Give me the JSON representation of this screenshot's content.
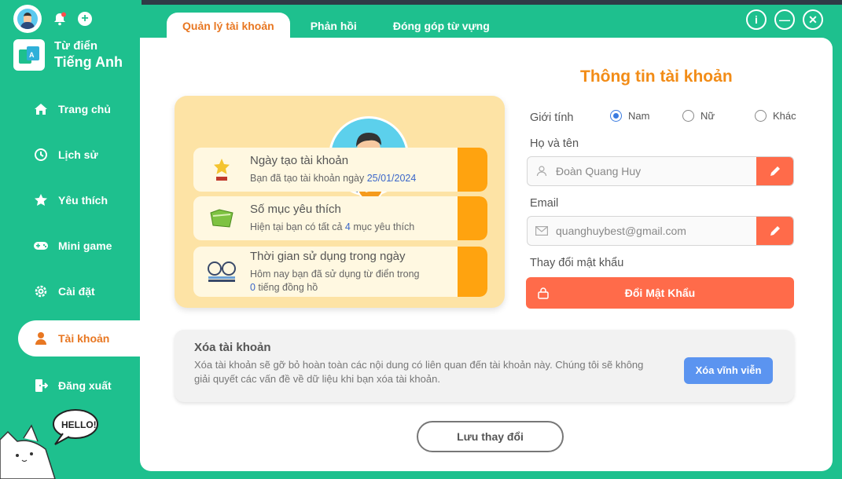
{
  "sidebar": {
    "app_title_line1": "Từ điển",
    "app_title_line2": "Tiếng Anh",
    "items": [
      {
        "label": "Trang chủ",
        "icon": "home-icon"
      },
      {
        "label": "Lịch sử",
        "icon": "history-icon"
      },
      {
        "label": "Yêu thích",
        "icon": "star-icon"
      },
      {
        "label": "Mini game",
        "icon": "gamepad-icon"
      },
      {
        "label": "Cài đặt",
        "icon": "gear-icon"
      },
      {
        "label": "Tài khoản",
        "icon": "user-icon",
        "active": true
      },
      {
        "label": "Đăng xuất",
        "icon": "logout-icon"
      }
    ],
    "mascot_text": "HELLO!"
  },
  "tabs": [
    {
      "label": "Quản lý tài khoản",
      "active": true
    },
    {
      "label": "Phản hồi"
    },
    {
      "label": "Đóng góp từ vựng"
    }
  ],
  "window_controls": {
    "info": "i",
    "minimize": "—",
    "close": "✕"
  },
  "stats": [
    {
      "title": "Ngày tạo tài khoản",
      "desc_prefix": "Bạn đã tạo tài khoản ngày ",
      "value": "25/01/2024",
      "desc_suffix": "",
      "icon": "trophy-icon"
    },
    {
      "title": "Số mục yêu thích",
      "desc_prefix": "Hiện tại bạn có tất cả ",
      "value": "4",
      "desc_suffix": " mục yêu thích",
      "icon": "folder-icon"
    },
    {
      "title": "Thời gian sử dụng trong ngày",
      "desc_prefix": "Hôm nay bạn đã sử dụng từ điển trong",
      "value": "0",
      "desc_suffix": " tiếng đồng hồ",
      "icon": "glasses-book-icon"
    }
  ],
  "profile": {
    "title": "Thông tin tài khoản",
    "gender_label": "Giới tính",
    "gender_options": [
      "Nam",
      "Nữ",
      "Khác"
    ],
    "gender_selected": "Nam",
    "name_label": "Họ và tên",
    "name_value": "Đoàn Quang Huy",
    "email_label": "Email",
    "email_value": "quanghuybest@gmail.com",
    "password_label": "Thay đổi mật khẩu",
    "password_button": "Đổi Mật Khẩu"
  },
  "delete_account": {
    "title": "Xóa tài khoản",
    "description": "Xóa tài khoản sẽ gỡ bỏ hoàn toàn các nội dung có liên quan đến tài khoản này. Chúng tôi sẽ không giải quyết các vấn đề về dữ liệu khi bạn xóa tài khoản.",
    "button": "Xóa vĩnh viễn"
  },
  "save_button": "Lưu thay đổi",
  "colors": {
    "brand": "#1ec08e",
    "accent": "#f28c17",
    "danger": "#ff6b4a",
    "primary": "#5b94f0"
  }
}
